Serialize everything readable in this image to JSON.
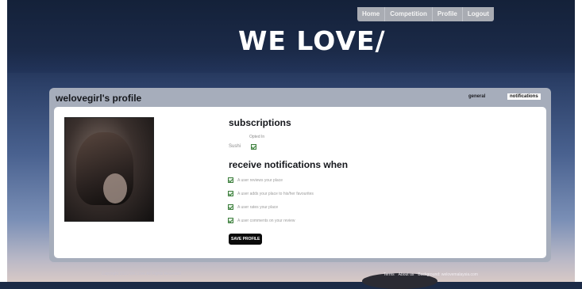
{
  "nav": {
    "items": [
      "Home",
      "Competition",
      "Profile",
      "Logout"
    ]
  },
  "logo": {
    "text": "WE LOVE/"
  },
  "profile": {
    "title": "welovegirl's profile",
    "tabs": {
      "general": "general",
      "notifications": "notifications"
    }
  },
  "subscriptions": {
    "heading": "subscriptions",
    "opted_in_label": "Opted In",
    "rows": [
      {
        "label": "Sushi",
        "checked": true
      }
    ]
  },
  "notifications": {
    "heading": "receive notifications when",
    "options": [
      {
        "label": "A user reviews your place",
        "checked": true
      },
      {
        "label": "A user adds your place to his/her favourites",
        "checked": true
      },
      {
        "label": "A user rates your place",
        "checked": true
      },
      {
        "label": "A user comments on your review",
        "checked": true
      }
    ]
  },
  "save_button": {
    "label": "SAVE PROFILE"
  },
  "footer": {
    "left": "Copyright 2010 We Love All Rights Reserved",
    "links": [
      "Terms",
      "About us",
      "Background: welovemalaysia.com"
    ]
  },
  "colors": {
    "accent_dark": "#0a0a0a",
    "nav_bg": "#a9acb3",
    "panel_bg": "#a6adbb",
    "check_green": "#2f7a2f"
  }
}
